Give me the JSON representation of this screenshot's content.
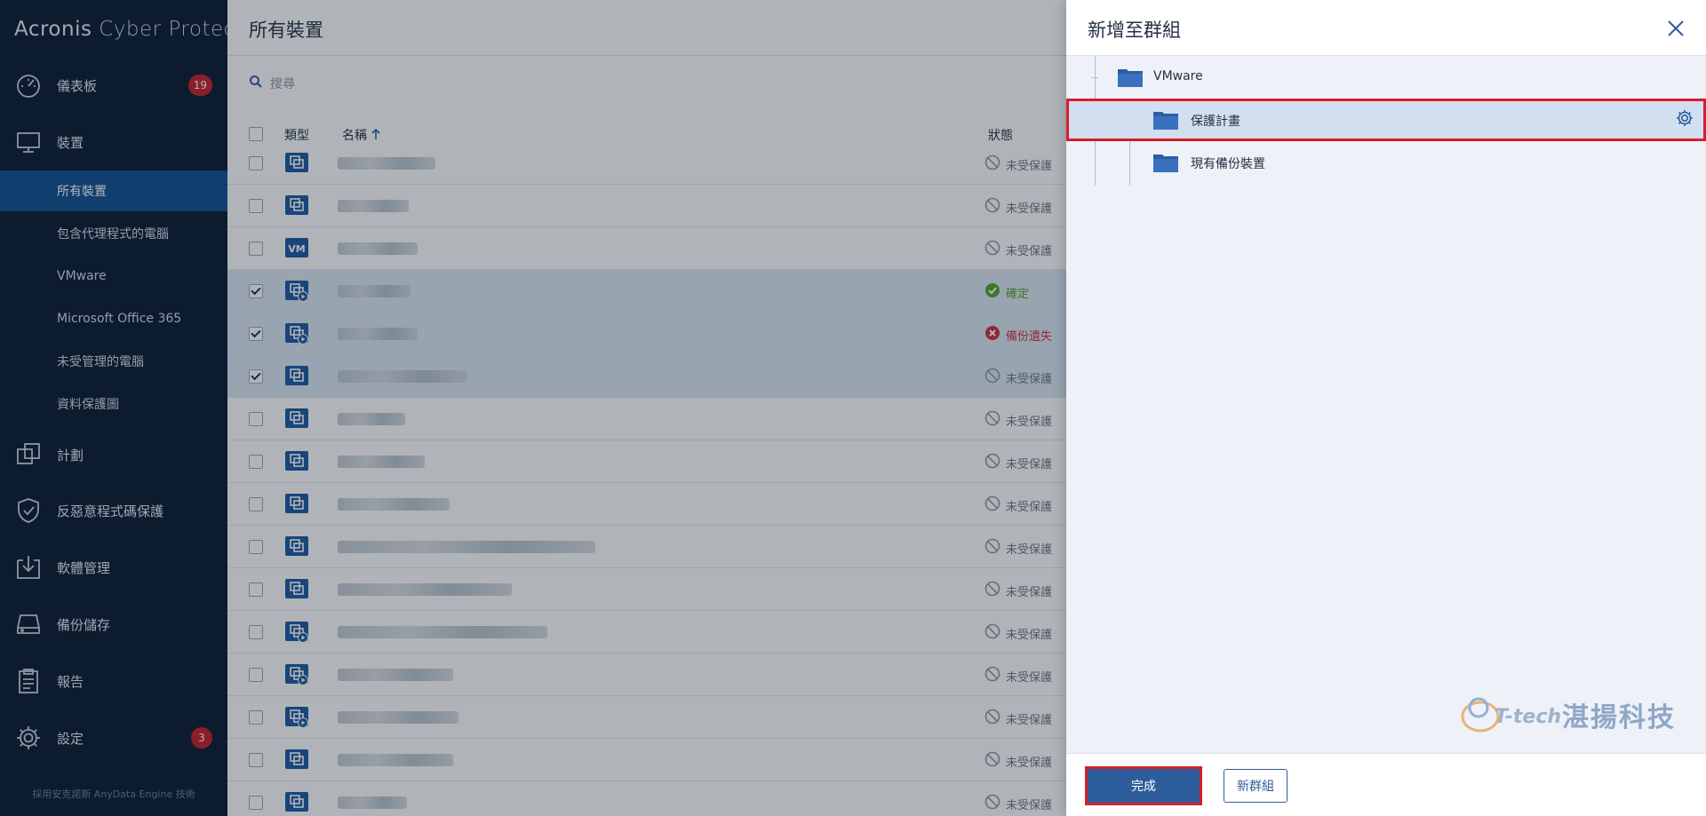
{
  "app": {
    "brand_main": "Acronis",
    "brand_sub": "Cyber Protect"
  },
  "sidebar": {
    "items": [
      {
        "label": "儀表板",
        "icon": "dashboard-gauge-icon",
        "badge": "19"
      },
      {
        "label": "裝置",
        "icon": "monitor-icon",
        "badge": ""
      },
      {
        "label": "計劃",
        "icon": "plans-copy-icon",
        "badge": ""
      },
      {
        "label": "反惡意程式碼保護",
        "icon": "shield-check-icon",
        "badge": ""
      },
      {
        "label": "軟體管理",
        "icon": "software-download-icon",
        "badge": ""
      },
      {
        "label": "備份儲存",
        "icon": "storage-drive-icon",
        "badge": ""
      },
      {
        "label": "報告",
        "icon": "report-clipboard-icon",
        "badge": ""
      },
      {
        "label": "設定",
        "icon": "gear-icon",
        "badge": "3"
      }
    ],
    "sub_items": [
      {
        "label": "所有裝置",
        "active": true
      },
      {
        "label": "包含代理程式的電腦",
        "active": false
      },
      {
        "label": "VMware",
        "active": false
      },
      {
        "label": "Microsoft Office 365",
        "active": false
      },
      {
        "label": "未受管理的電腦",
        "active": false
      },
      {
        "label": "資料保護圖",
        "active": false
      }
    ],
    "footer": "採用安克諾斯 AnyData Engine 技術"
  },
  "main": {
    "title": "所有裝置",
    "search_placeholder": "搜尋",
    "columns": {
      "type": "類型",
      "name": "名稱",
      "status": "狀態"
    },
    "rows": [
      {
        "checked": false,
        "icon": "vm-copy-icon",
        "status": "未受保護",
        "status_kind": "unprotected"
      },
      {
        "checked": false,
        "icon": "vm-copy-icon",
        "status": "未受保護",
        "status_kind": "unprotected"
      },
      {
        "checked": false,
        "icon": "vm-label-icon",
        "status": "未受保護",
        "status_kind": "unprotected"
      },
      {
        "checked": true,
        "icon": "vm-play-icon",
        "status": "確定",
        "status_kind": "ok"
      },
      {
        "checked": true,
        "icon": "vm-play-icon",
        "status": "備份遺失",
        "status_kind": "error"
      },
      {
        "checked": true,
        "icon": "vm-copy-icon",
        "status": "未受保護",
        "status_kind": "unprotected"
      },
      {
        "checked": false,
        "icon": "vm-copy-icon",
        "status": "未受保護",
        "status_kind": "unprotected"
      },
      {
        "checked": false,
        "icon": "vm-copy-icon",
        "status": "未受保護",
        "status_kind": "unprotected"
      },
      {
        "checked": false,
        "icon": "vm-copy-icon",
        "status": "未受保護",
        "status_kind": "unprotected"
      },
      {
        "checked": false,
        "icon": "vm-copy-icon",
        "status": "未受保護",
        "status_kind": "unprotected"
      },
      {
        "checked": false,
        "icon": "vm-copy-icon",
        "status": "未受保護",
        "status_kind": "unprotected"
      },
      {
        "checked": false,
        "icon": "vm-play-icon",
        "status": "未受保護",
        "status_kind": "unprotected"
      },
      {
        "checked": false,
        "icon": "vm-play-icon",
        "status": "未受保護",
        "status_kind": "unprotected"
      },
      {
        "checked": false,
        "icon": "vm-play-icon",
        "status": "未受保護",
        "status_kind": "unprotected"
      },
      {
        "checked": false,
        "icon": "vm-copy-icon",
        "status": "未受保護",
        "status_kind": "unprotected"
      },
      {
        "checked": false,
        "icon": "vm-copy-icon",
        "status": "未受保護",
        "status_kind": "unprotected"
      }
    ]
  },
  "panel": {
    "title": "新增至群組",
    "tree": [
      {
        "label": "VMware",
        "level": 0,
        "selected": false
      },
      {
        "label": "保護計畫",
        "level": 1,
        "selected": true
      },
      {
        "label": "現有備份裝置",
        "level": 1,
        "selected": false
      }
    ],
    "watermark_logo": "T-tech",
    "watermark_text": "湛揚科技",
    "done_label": "完成",
    "new_group_label": "新群組"
  },
  "colors": {
    "sidebar_bg": "#0c1c33",
    "active_nav": "#0f4f93",
    "accent": "#2e5d9b",
    "badge": "#c8202e",
    "highlight": "#d3202a"
  }
}
